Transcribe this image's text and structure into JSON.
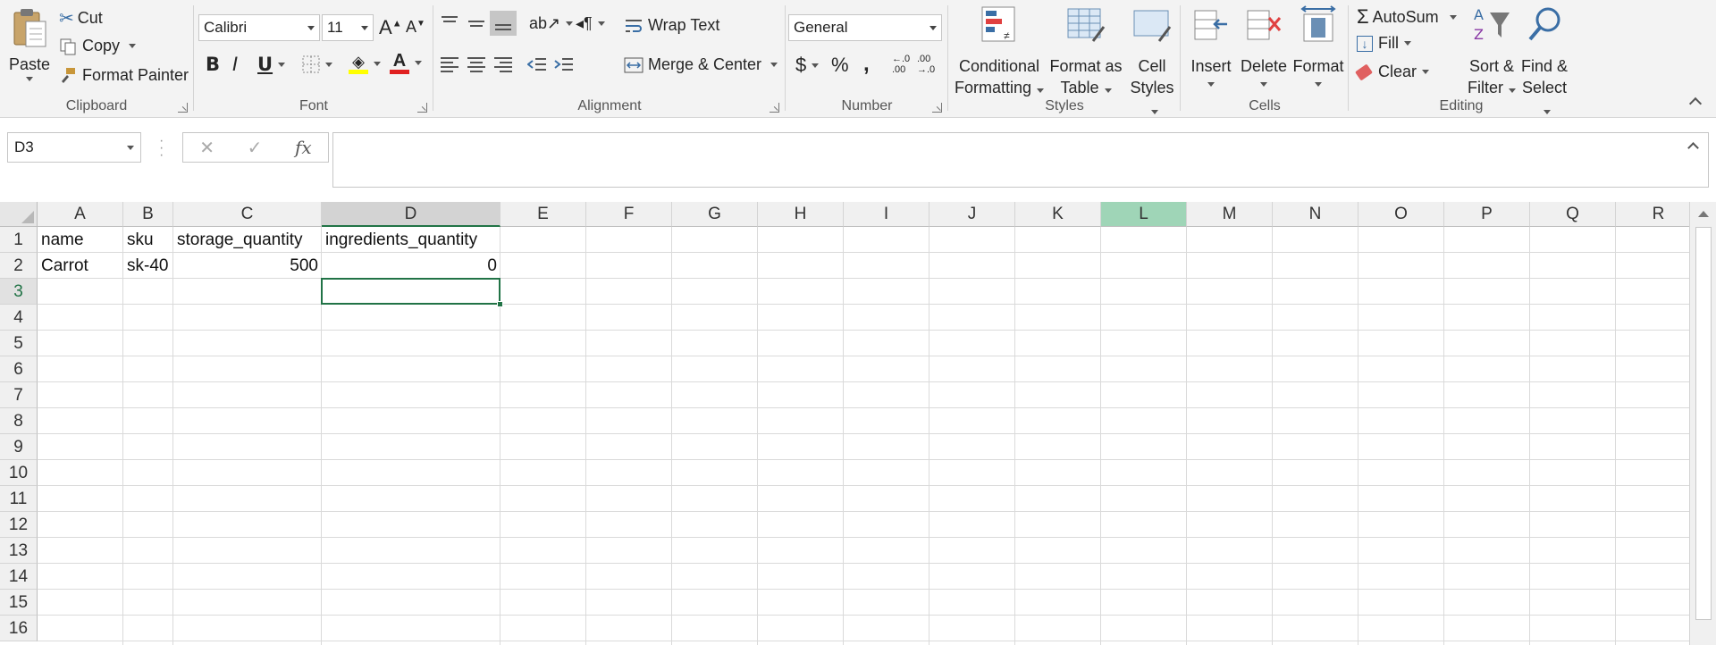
{
  "ribbon": {
    "clipboard": {
      "paste": "Paste",
      "cut": "Cut",
      "copy": "Copy",
      "format_painter": "Format Painter",
      "label": "Clipboard"
    },
    "font": {
      "family": "Calibri",
      "size": "11",
      "bold": "B",
      "italic": "I",
      "underline": "U",
      "label": "Font"
    },
    "alignment": {
      "wrap_text": "Wrap Text",
      "merge_center": "Merge & Center",
      "label": "Alignment"
    },
    "number": {
      "format": "General",
      "currency": "$",
      "percent": "%",
      "comma": ",",
      "inc_decimal": "←.0\n.00",
      "dec_decimal": ".00\n→.0",
      "label": "Number"
    },
    "styles": {
      "conditional_1": "Conditional",
      "conditional_2": "Formatting",
      "format_table_1": "Format as",
      "format_table_2": "Table",
      "cell_styles_1": "Cell",
      "cell_styles_2": "Styles",
      "label": "Styles"
    },
    "cells": {
      "insert": "Insert",
      "delete": "Delete",
      "format": "Format",
      "label": "Cells"
    },
    "editing": {
      "autosum": "AutoSum",
      "fill": "Fill",
      "clear": "Clear",
      "sort_1": "Sort &",
      "sort_2": "Filter",
      "find_1": "Find &",
      "find_2": "Select",
      "label": "Editing"
    }
  },
  "formula_bar": {
    "name_box": "D3",
    "cancel": "✕",
    "enter": "✓",
    "fx": "fx",
    "content": ""
  },
  "grid": {
    "columns": [
      "A",
      "B",
      "C",
      "D",
      "E",
      "F",
      "G",
      "H",
      "I",
      "J",
      "K",
      "L",
      "M",
      "N",
      "O",
      "P",
      "Q",
      "R"
    ],
    "rows": [
      "1",
      "2",
      "3",
      "4",
      "5",
      "6",
      "7",
      "8",
      "9",
      "10",
      "11",
      "12",
      "13",
      "14",
      "15",
      "16"
    ],
    "selected_column": "D",
    "highlighted_column": "L",
    "selected_row": "3",
    "cells": {
      "A1": "name",
      "B1": "sku",
      "C1": "storage_quantity",
      "D1": "ingredients_quantity",
      "A2": "Carrot",
      "B2": "sk-40",
      "C2": "500",
      "D2": "0"
    }
  },
  "colors": {
    "accent": "#217346",
    "highlight_col": "#9fd5b7"
  }
}
